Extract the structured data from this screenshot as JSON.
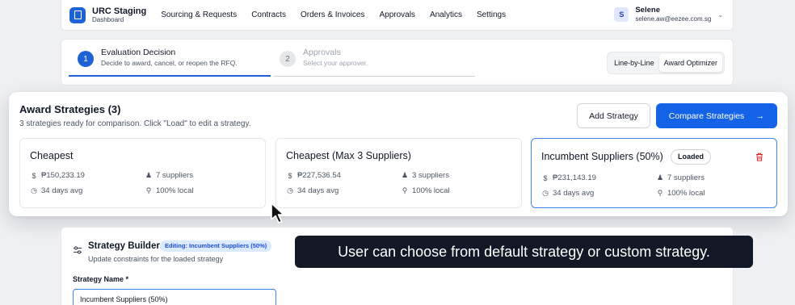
{
  "nav": {
    "brand_title": "URC Staging",
    "brand_sub": "Dashboard",
    "links": [
      "Sourcing & Requests",
      "Contracts",
      "Orders & Invoices",
      "Approvals",
      "Analytics",
      "Settings"
    ],
    "user_initial": "S",
    "user_name": "Selene",
    "user_email": "selene.aw@eezee.com.sg"
  },
  "stepper": {
    "steps": [
      {
        "num": "1",
        "title": "Evaluation Decision",
        "subtitle": "Decide to award, cancel, or reopen the RFQ.",
        "state": "active"
      },
      {
        "num": "2",
        "title": "Approvals",
        "subtitle": "Select your approver.",
        "state": "inactive"
      }
    ],
    "view_toggle": [
      "Line-by-Line",
      "Award Optimizer"
    ],
    "view_selected": "Award Optimizer"
  },
  "award": {
    "title": "Award Strategies (3)",
    "subtitle": "3 strategies ready for comparison. Click \"Load\" to edit a strategy.",
    "add_label": "Add Strategy",
    "compare_label": "Compare Strategies",
    "strategies": [
      {
        "name": "Cheapest",
        "price": "₱150,233.19",
        "suppliers": "7 suppliers",
        "days": "34 days avg",
        "local": "100% local",
        "loaded": false
      },
      {
        "name": "Cheapest (Max 3 Suppliers)",
        "price": "₱227,536.54",
        "suppliers": "3 suppliers",
        "days": "34 days avg",
        "local": "100% local",
        "loaded": false
      },
      {
        "name": "Incumbent Suppliers (50%)",
        "price": "₱231,143.19",
        "suppliers": "7 suppliers",
        "days": "34 days avg",
        "local": "100% local",
        "loaded": true,
        "badge": "Loaded"
      }
    ]
  },
  "builder": {
    "title": "Strategy Builder",
    "badge": "Editing: Incumbent Suppliers (50%)",
    "subtitle": "Update constraints for the loaded strategy",
    "name_label": "Strategy Name *",
    "name_value": "Incumbent Suppliers (50%)"
  },
  "tooltip": "User can choose from default strategy or custom strategy.",
  "colors": {
    "accent": "#1463e6",
    "danger": "#dc2626",
    "tooltip_bg": "#121826"
  }
}
